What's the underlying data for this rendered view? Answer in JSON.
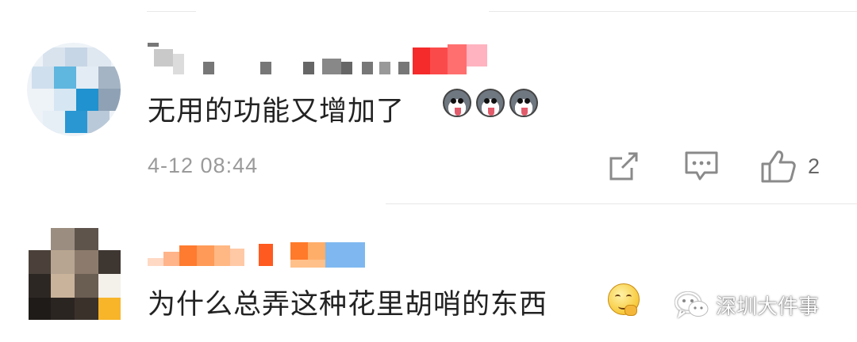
{
  "comments": [
    {
      "text": "无用的功能又增加了",
      "emojis": [
        "dog-icon",
        "dog-icon",
        "dog-icon"
      ],
      "timestamp": "4-12 08:44",
      "actions": {
        "share_icon": "share-icon",
        "reply_icon": "comment-icon",
        "like_icon": "thumbs-up-icon",
        "like_count": "2"
      }
    },
    {
      "text": "为什么总弄这种花里胡哨的东西",
      "emojis": [
        "smirk-icon"
      ]
    }
  ],
  "watermark": {
    "icon": "wechat-icon",
    "label": "深圳大件事"
  },
  "colors": {
    "text": "#222222",
    "meta": "#9a9a9a",
    "icon": "#8a8a8a",
    "divider": "#e8e8e8"
  }
}
